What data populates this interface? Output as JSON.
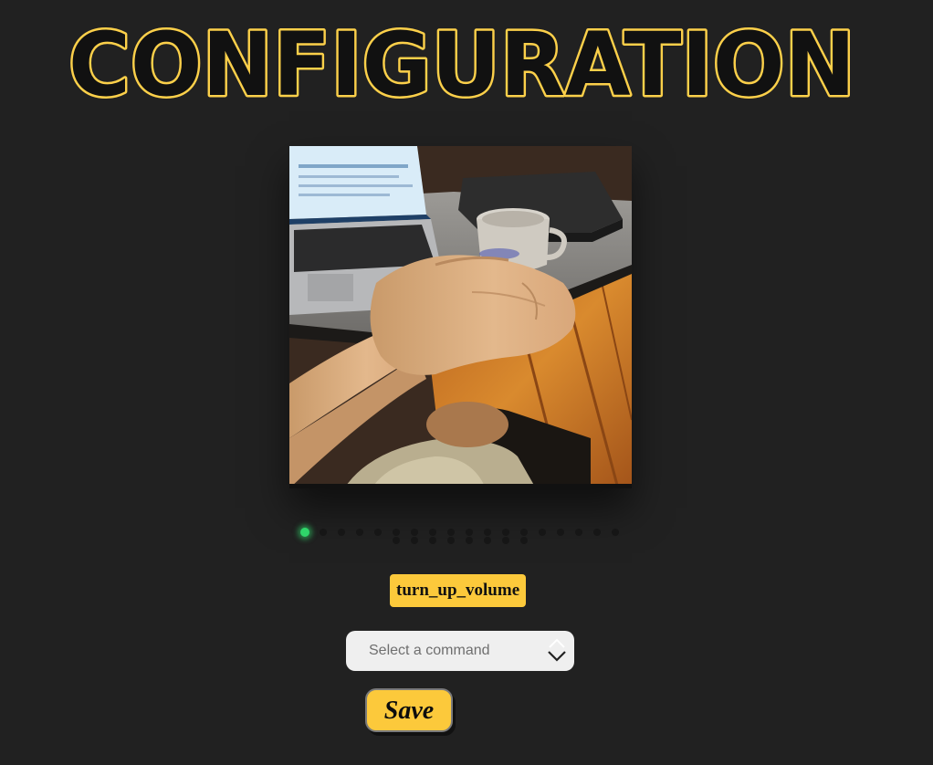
{
  "header": {
    "title": "CONFIGURATION",
    "title_fill": "#111111",
    "title_stroke": "#fcd04a"
  },
  "gallery": {
    "image_alt": "Photo of a clenched fist gesture above a desk with a laptop and a mug",
    "active_index": 0,
    "dot_count": 24
  },
  "command": {
    "current_label": "turn_up_volume",
    "select_placeholder": "Select a command"
  },
  "actions": {
    "save_label": "Save"
  },
  "colors": {
    "background": "#212121",
    "accent": "#fcc93b",
    "active_dot": "#2fd66a"
  }
}
